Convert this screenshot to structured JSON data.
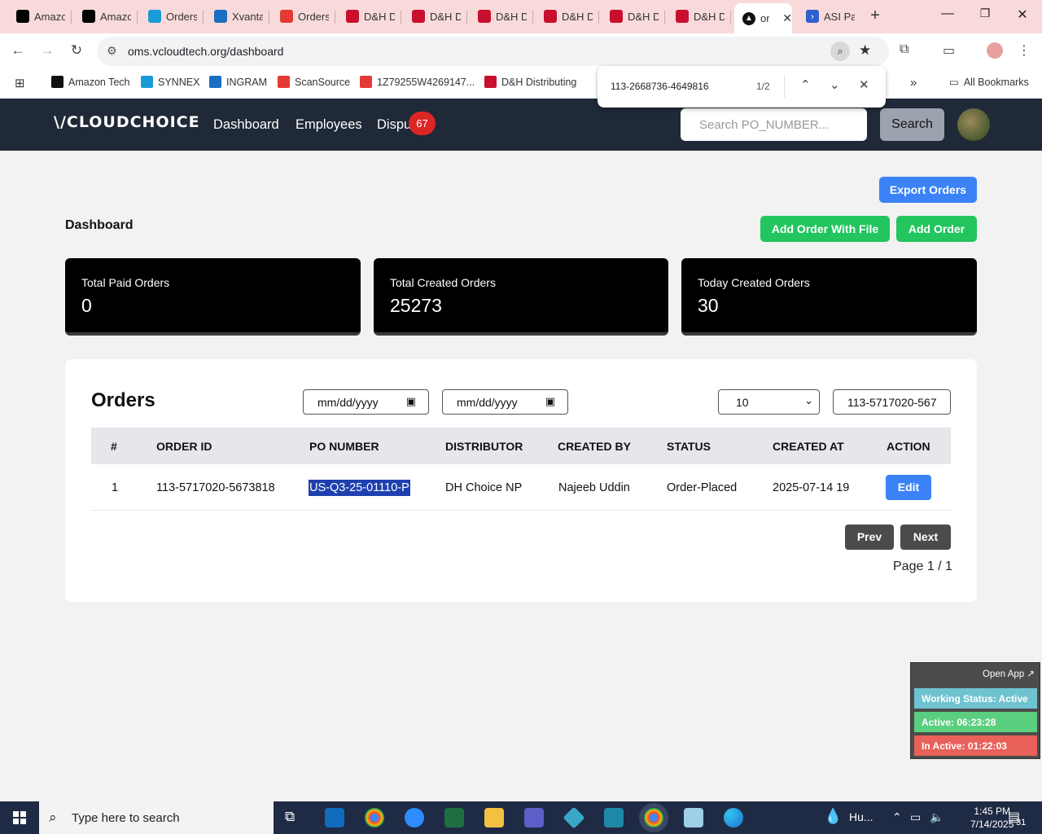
{
  "browser": {
    "tabs": [
      {
        "title": "Amazo",
        "icon": "amazon-icon",
        "color": "#000000"
      },
      {
        "title": "Amazo",
        "icon": "amazon-icon",
        "color": "#000000"
      },
      {
        "title": "Orders",
        "icon": "ec-icon",
        "color": "#1a9ad6"
      },
      {
        "title": "Xvanta",
        "icon": "xvantage-icon",
        "color": "#1a6fc2"
      },
      {
        "title": "Orders",
        "icon": "scansource-icon",
        "color": "#e53935"
      },
      {
        "title": "D&H D",
        "icon": "dh-icon",
        "color": "#c8102e"
      },
      {
        "title": "D&H D",
        "icon": "dh-icon",
        "color": "#c8102e"
      },
      {
        "title": "D&H D",
        "icon": "dh-icon",
        "color": "#c8102e"
      },
      {
        "title": "D&H D",
        "icon": "dh-icon",
        "color": "#c8102e"
      },
      {
        "title": "D&H D",
        "icon": "dh-icon",
        "color": "#c8102e"
      },
      {
        "title": "D&H D",
        "icon": "dh-icon",
        "color": "#c8102e"
      }
    ],
    "active_tab": {
      "title": "or",
      "icon": "vcloud-icon"
    },
    "last_tab": {
      "title": "ASI Pa",
      "icon": "asi-icon"
    },
    "url": "oms.vcloudtech.org/dashboard",
    "bookmarks": [
      {
        "label": "Amazon Tech",
        "icon": "amazon-icon"
      },
      {
        "label": "SYNNEX",
        "icon": "ec-icon"
      },
      {
        "label": "INGRAM",
        "icon": "ingram-icon"
      },
      {
        "label": "ScanSource",
        "icon": "scansource-icon"
      },
      {
        "label": "1Z79255W4269147...",
        "icon": "scansource-icon"
      },
      {
        "label": "D&H Distributing",
        "icon": "dh-icon"
      }
    ],
    "all_bookmarks": "All Bookmarks",
    "find": {
      "query": "113-2668736-4649816",
      "count": "1/2"
    }
  },
  "app": {
    "logo": "\\/CLOUDCHOICE",
    "nav": {
      "dashboard": "Dashboard",
      "employees": "Employees",
      "disputes": "Dispu",
      "disputes_badge": "67"
    },
    "search": {
      "placeholder": "Search PO_NUMBER...",
      "button": "Search"
    }
  },
  "page": {
    "title": "Dashboard",
    "export_button": "Export Orders",
    "add_with_file_button": "Add Order With File",
    "add_order_button": "Add Order",
    "stats": [
      {
        "label": "Total Paid Orders",
        "value": "0"
      },
      {
        "label": "Total Created Orders",
        "value": "25273"
      },
      {
        "label": "Today Created Orders",
        "value": "30"
      }
    ]
  },
  "orders": {
    "heading": "Orders",
    "date_from": "mm/dd/yyyy",
    "date_to": "mm/dd/yyyy",
    "page_size": "10",
    "filter_value": "113-5717020-567",
    "columns": [
      "#",
      "ORDER ID",
      "PO NUMBER",
      "DISTRIBUTOR",
      "CREATED BY",
      "STATUS",
      "CREATED AT",
      "ACTION"
    ],
    "rows": [
      {
        "num": "1",
        "order_id": "113-5717020-5673818",
        "po_number": "US-Q3-25-01110-P",
        "distributor": "DH Choice NP",
        "created_by": "Najeeb Uddin",
        "status": "Order-Placed",
        "created_at": "2025-07-14 19",
        "action": "Edit"
      }
    ],
    "prev": "Prev",
    "next": "Next",
    "page_info": "Page 1 / 1"
  },
  "tracker": {
    "open_app": "Open App ↗",
    "working_status": "Working Status: Active",
    "active": "Active: 06:23:28",
    "inactive": "In Active: 01:22:03"
  },
  "taskbar": {
    "search_placeholder": "Type here to search",
    "weather": "Hu...",
    "time": "1:45 PM",
    "date": "7/14/2025",
    "notifications": "31"
  },
  "colors": {
    "header_bg": "#1f2937",
    "primary_blue": "#3b82f6",
    "success_green": "#22c55e",
    "badge_red": "#dc2626",
    "tracker_status": "#6fc3d0",
    "tracker_active": "#5bcf80",
    "tracker_inactive": "#e8615a"
  }
}
